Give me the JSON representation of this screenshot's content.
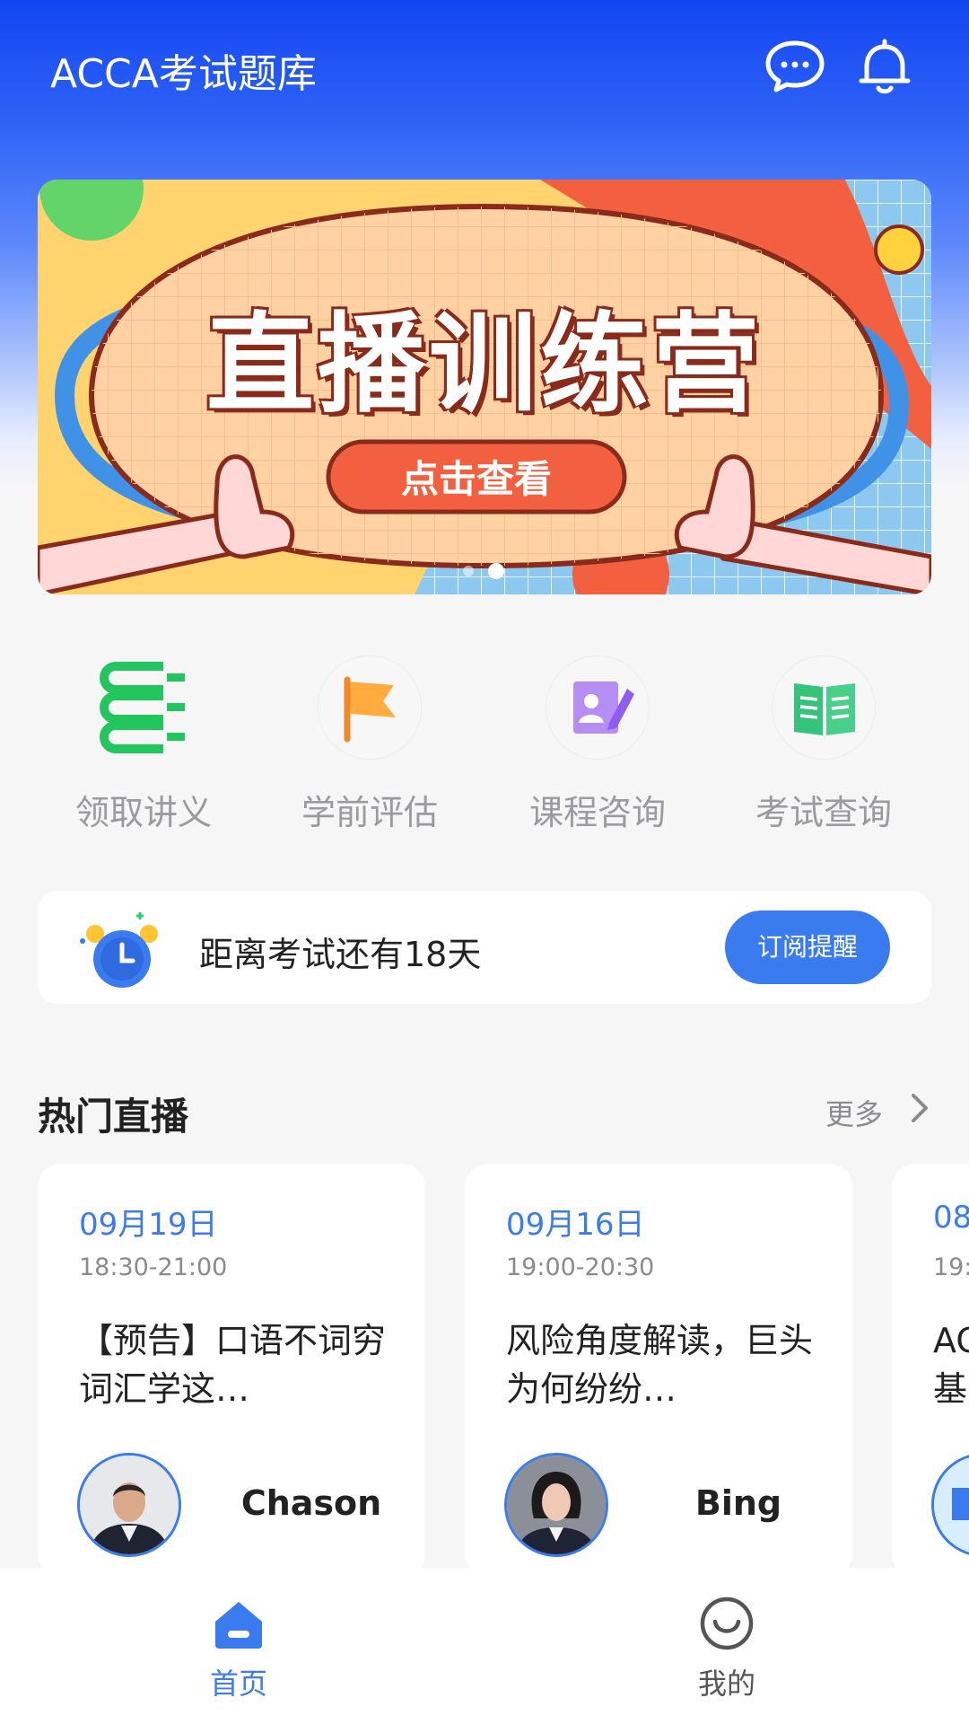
{
  "header": {
    "title": "ACCA考试题库",
    "message_icon": "chat-bubble-icon",
    "bell_icon": "bell-icon"
  },
  "banner": {
    "title": "直播训练营",
    "button": "点击查看",
    "page_count": 2,
    "active_index": 1
  },
  "entries": [
    {
      "label": "领取讲义",
      "icon": "books-icon"
    },
    {
      "label": "学前评估",
      "icon": "flag-icon"
    },
    {
      "label": "课程咨询",
      "icon": "consult-icon"
    },
    {
      "label": "考试查询",
      "icon": "open-book-icon"
    }
  ],
  "countdown": {
    "text": "距离考试还有18天",
    "button": "订阅提醒",
    "icon": "alarm-clock-icon"
  },
  "section": {
    "title": "热门直播",
    "more": "更多"
  },
  "cards": [
    {
      "date": "09月19日",
      "time": "18:30-21:00",
      "title": "【预告】口语不词穷 词汇学这…",
      "name": "Chason"
    },
    {
      "date": "09月16日",
      "time": "19:00-20:30",
      "title": "风险角度解读，巨头为何纷纷…",
      "name": "Bing"
    },
    {
      "date": "08",
      "time": "19:",
      "title": "AC基",
      "name": ""
    }
  ],
  "nav": {
    "home": "首页",
    "mine": "我的"
  },
  "colors": {
    "accent": "#3a7bf0",
    "header_top": "#1246f2"
  }
}
